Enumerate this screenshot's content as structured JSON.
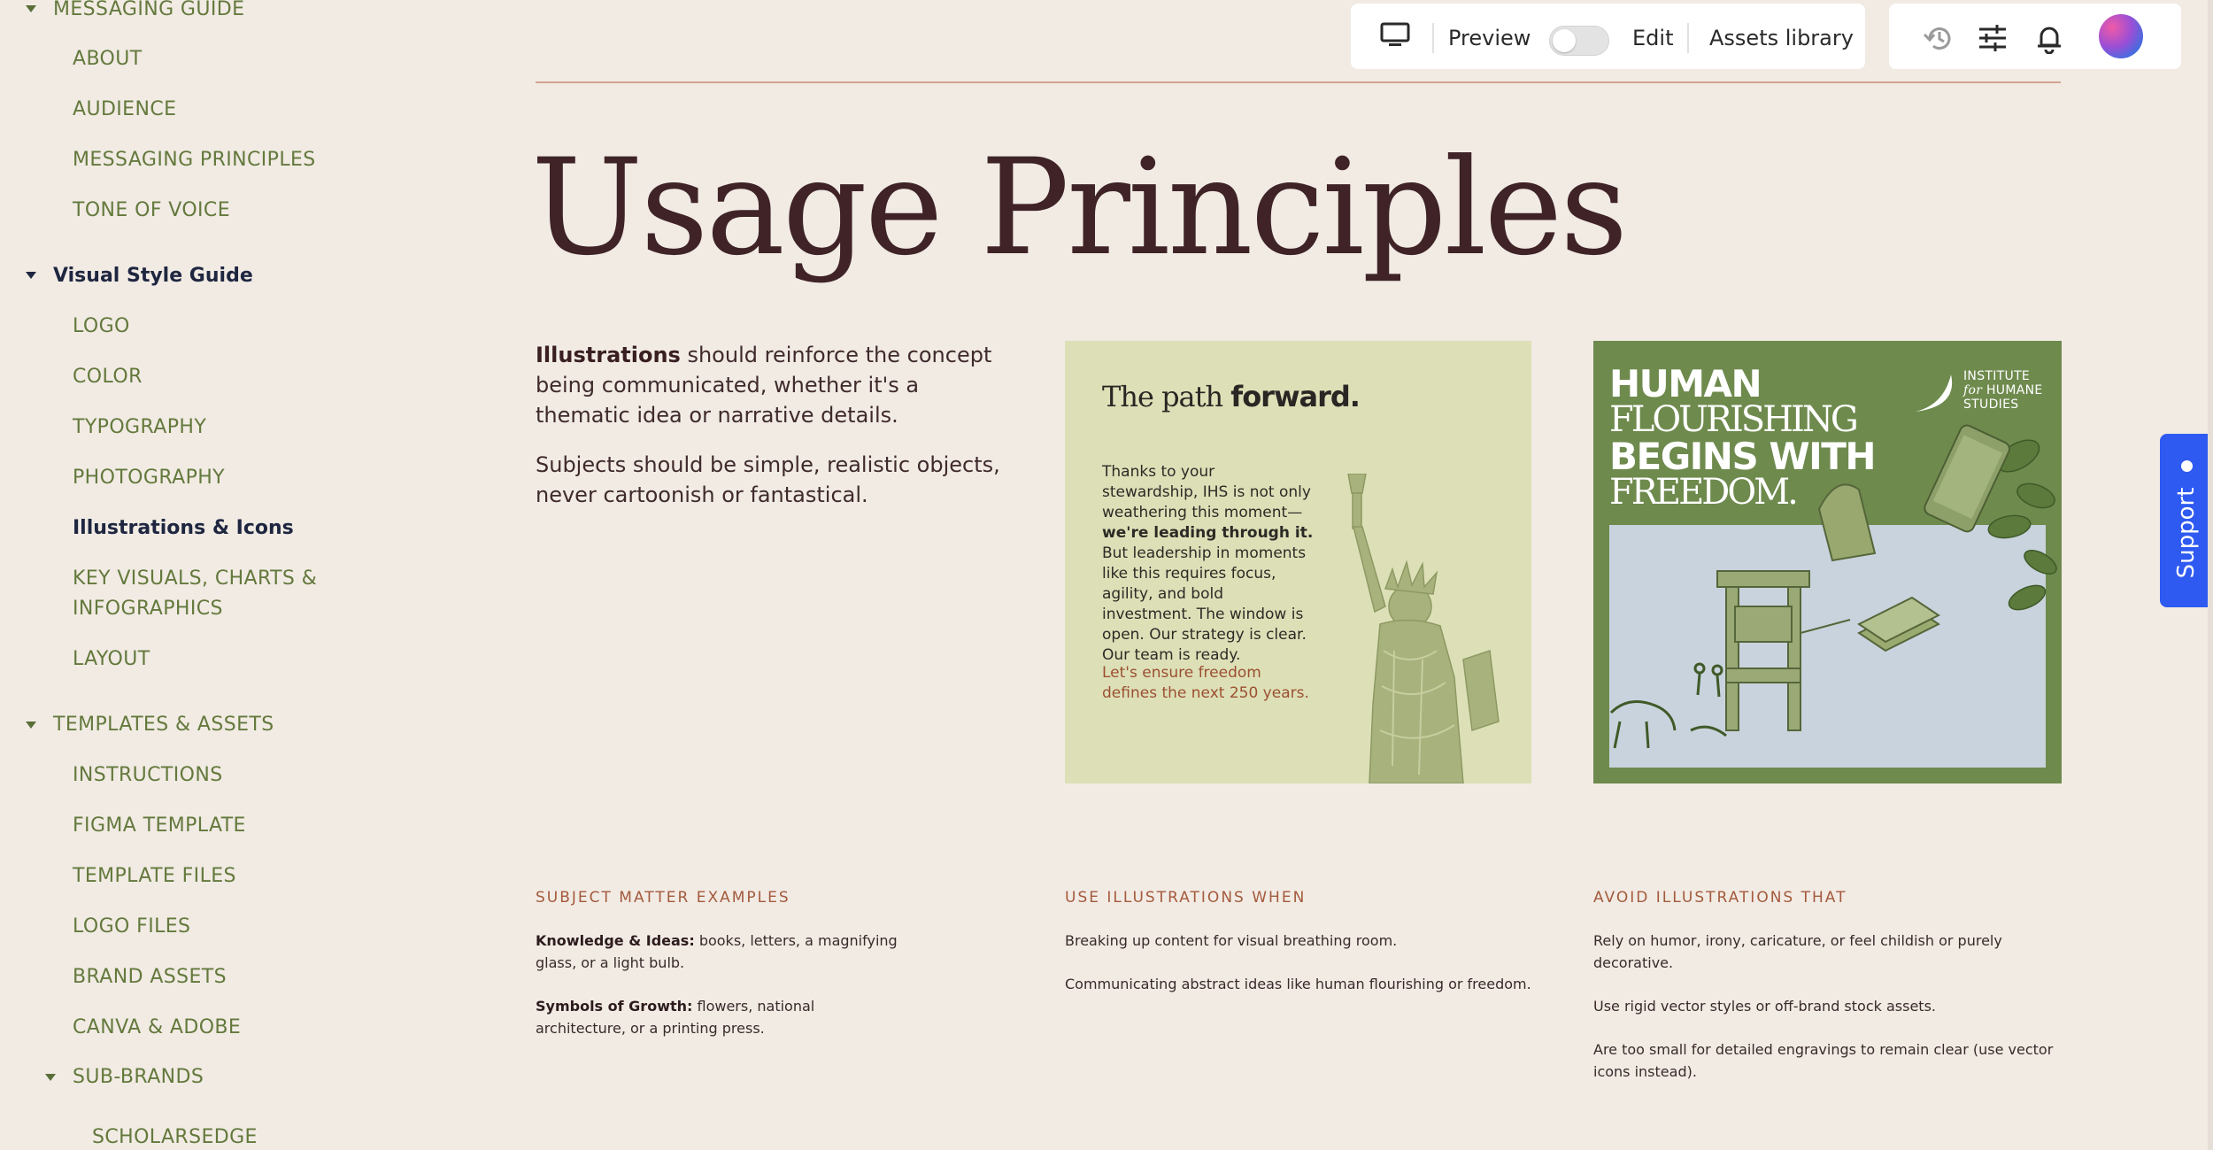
{
  "sidebar": {
    "sections": [
      {
        "label": "MESSAGING GUIDE"
      },
      {
        "label": "Visual Style Guide"
      },
      {
        "label": "TEMPLATES & ASSETS"
      },
      {
        "label": "SUB-BRANDS"
      }
    ],
    "items": [
      {
        "label": "ABOUT"
      },
      {
        "label": "AUDIENCE"
      },
      {
        "label": "MESSAGING PRINCIPLES"
      },
      {
        "label": "TONE OF VOICE"
      },
      {
        "label": "LOGO"
      },
      {
        "label": "COLOR"
      },
      {
        "label": "TYPOGRAPHY"
      },
      {
        "label": "PHOTOGRAPHY"
      },
      {
        "label": "Illustrations & Icons"
      },
      {
        "label": "KEY VISUALS, CHARTS &"
      },
      {
        "label": "INFOGRAPHICS"
      },
      {
        "label": "LAYOUT"
      },
      {
        "label": "INSTRUCTIONS"
      },
      {
        "label": "FIGMA TEMPLATE"
      },
      {
        "label": "TEMPLATE FILES"
      },
      {
        "label": "LOGO FILES"
      },
      {
        "label": "BRAND ASSETS"
      },
      {
        "label": "CANVA & ADOBE"
      },
      {
        "label": "SCHOLARSEDGE"
      }
    ]
  },
  "toolbar": {
    "device_icon": "monitor-icon",
    "preview_label": "Preview",
    "edit_label": "Edit",
    "assets_label": "Assets library",
    "history_icon": "history-icon",
    "settings_icon": "sliders-icon",
    "notifications_icon": "bell-icon"
  },
  "main": {
    "title": "Usage Principles",
    "intro": {
      "p1_bold": "Illustrations",
      "p1_rest": " should reinforce the concept being communicated, whether it's a thematic idea or narrative details.",
      "p2": "Subjects should be simple, realistic objects, never cartoonish or fantastical."
    }
  },
  "card1": {
    "title_light": "The path ",
    "title_bold": "forward.",
    "body_a": "Thanks to your stewardship, IHS is not only weathering this moment—",
    "body_bold": "we're leading through it.",
    "body_b": " But leadership in moments like this requires focus, agility, and bold investment. The window is open. Our strategy is clear. Our team is ready.",
    "cta": "Let's ensure freedom defines the next 250 years."
  },
  "card2": {
    "headline_1": "HUMAN",
    "headline_2": "FLOURISHING",
    "headline_3": "BEGINS WITH",
    "headline_4": "FREEDOM.",
    "logo_line1": "INSTITUTE",
    "logo_line2_for": "for",
    "logo_line2_rest": " HUMANE",
    "logo_line3": "STUDIES"
  },
  "columns": {
    "subjects": {
      "heading": "SUBJECT MATTER EXAMPLES",
      "p1_bold": "Knowledge & Ideas:",
      "p1_rest": " books, letters, a magnifying glass, or a light bulb.",
      "p2_bold": "Symbols of Growth:",
      "p2_rest": " flowers, national architecture, or a printing press."
    },
    "use": {
      "heading": "USE ILLUSTRATIONS WHEN",
      "p1": "Breaking up content for visual breathing room.",
      "p2": "Communicating abstract ideas like human flourishing or freedom."
    },
    "avoid": {
      "heading": "AVOID ILLUSTRATIONS THAT",
      "p1": "Rely on humor, irony, caricature, or feel childish or purely decorative.",
      "p2": "Use rigid vector styles or off-brand stock assets.",
      "p3": "Are too small for detailed engravings to remain clear (use vector icons instead)."
    }
  },
  "support": {
    "label": "Support"
  },
  "colors": {
    "background": "#f1ebe4",
    "nav_green": "#64793c",
    "nav_active": "#1f2640",
    "title": "#3f2327",
    "accent_rust": "#a45a3c",
    "card1_bg": "#dde0b7",
    "card2_bg": "#6e8a4d",
    "support_blue": "#2e5af1"
  }
}
